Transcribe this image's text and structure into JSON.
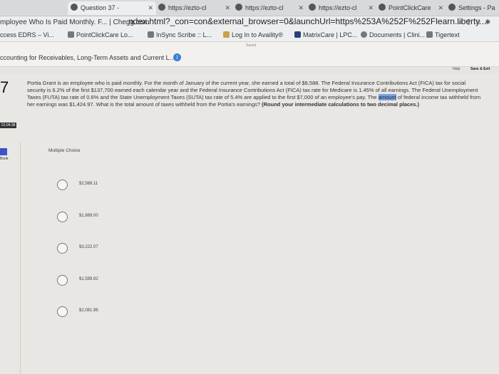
{
  "browser": {
    "tabs": [
      {
        "label": "Question 37 -"
      },
      {
        "label": "https://ezto-cl"
      },
      {
        "label": "https://ezto-cl"
      },
      {
        "label": "https://ezto-cl"
      },
      {
        "label": "PointClickCare"
      },
      {
        "label": "Settings - Pa"
      }
    ],
    "page_title": "mployee Who Is Paid Monthly. F... | Chegg.com",
    "url": "ndex.html?_con=con&external_browser=0&launchUrl=https%253A%252F%252Flearn.liberty...",
    "bookmarks": [
      {
        "label": "ccess EDRS – Vi..."
      },
      {
        "label": "PointClickCare Lo..."
      },
      {
        "label": "InSync Scribe :: L..."
      },
      {
        "label": "Log In to Availity®"
      },
      {
        "label": "MatrixCare | LPC..."
      },
      {
        "label": "Documents | Clini..."
      },
      {
        "label": "Tigertext"
      }
    ]
  },
  "app": {
    "title": "ccounting for Receivables, Long-Term Assets and Current L...",
    "saved": "Saved",
    "help": "Help",
    "save_exit": "Save & Exit"
  },
  "question": {
    "number": "7",
    "timer": "01:04:38",
    "ebook": "Book",
    "text_main": "Portia Grant is an employee who is paid monthly. For the month of January of the current year, she earned a total of $8,588. The Federal Insurance Contributions Act (FICA) tax for social security is 6.2% of the first $137,700 earned each calendar year and the Federal Insurance Contributions Act (FICA) tax rate for Medicare is 1.45% of all earnings. The Federal Unemployment Taxes (FUTA) tax rate of 0.6% and the State Unemployment Taxes (SUTA) tax rate of 5.4% are applied to the first $7,000 of an employee's pay. The ",
    "text_highlight": "amount",
    "text_after": " of federal income tax withheld from her earnings was $1,424.97. What is the total amount of taxes withheld from the Portia's earnings? ",
    "text_bold": "(Round your intermediate calculations to two decimal places.)",
    "mc_label": "Multiple Choice",
    "choices": [
      "$2,568.11",
      "$1,889.00",
      "$3,222.07",
      "$1,599.92",
      "$2,081.96"
    ]
  }
}
